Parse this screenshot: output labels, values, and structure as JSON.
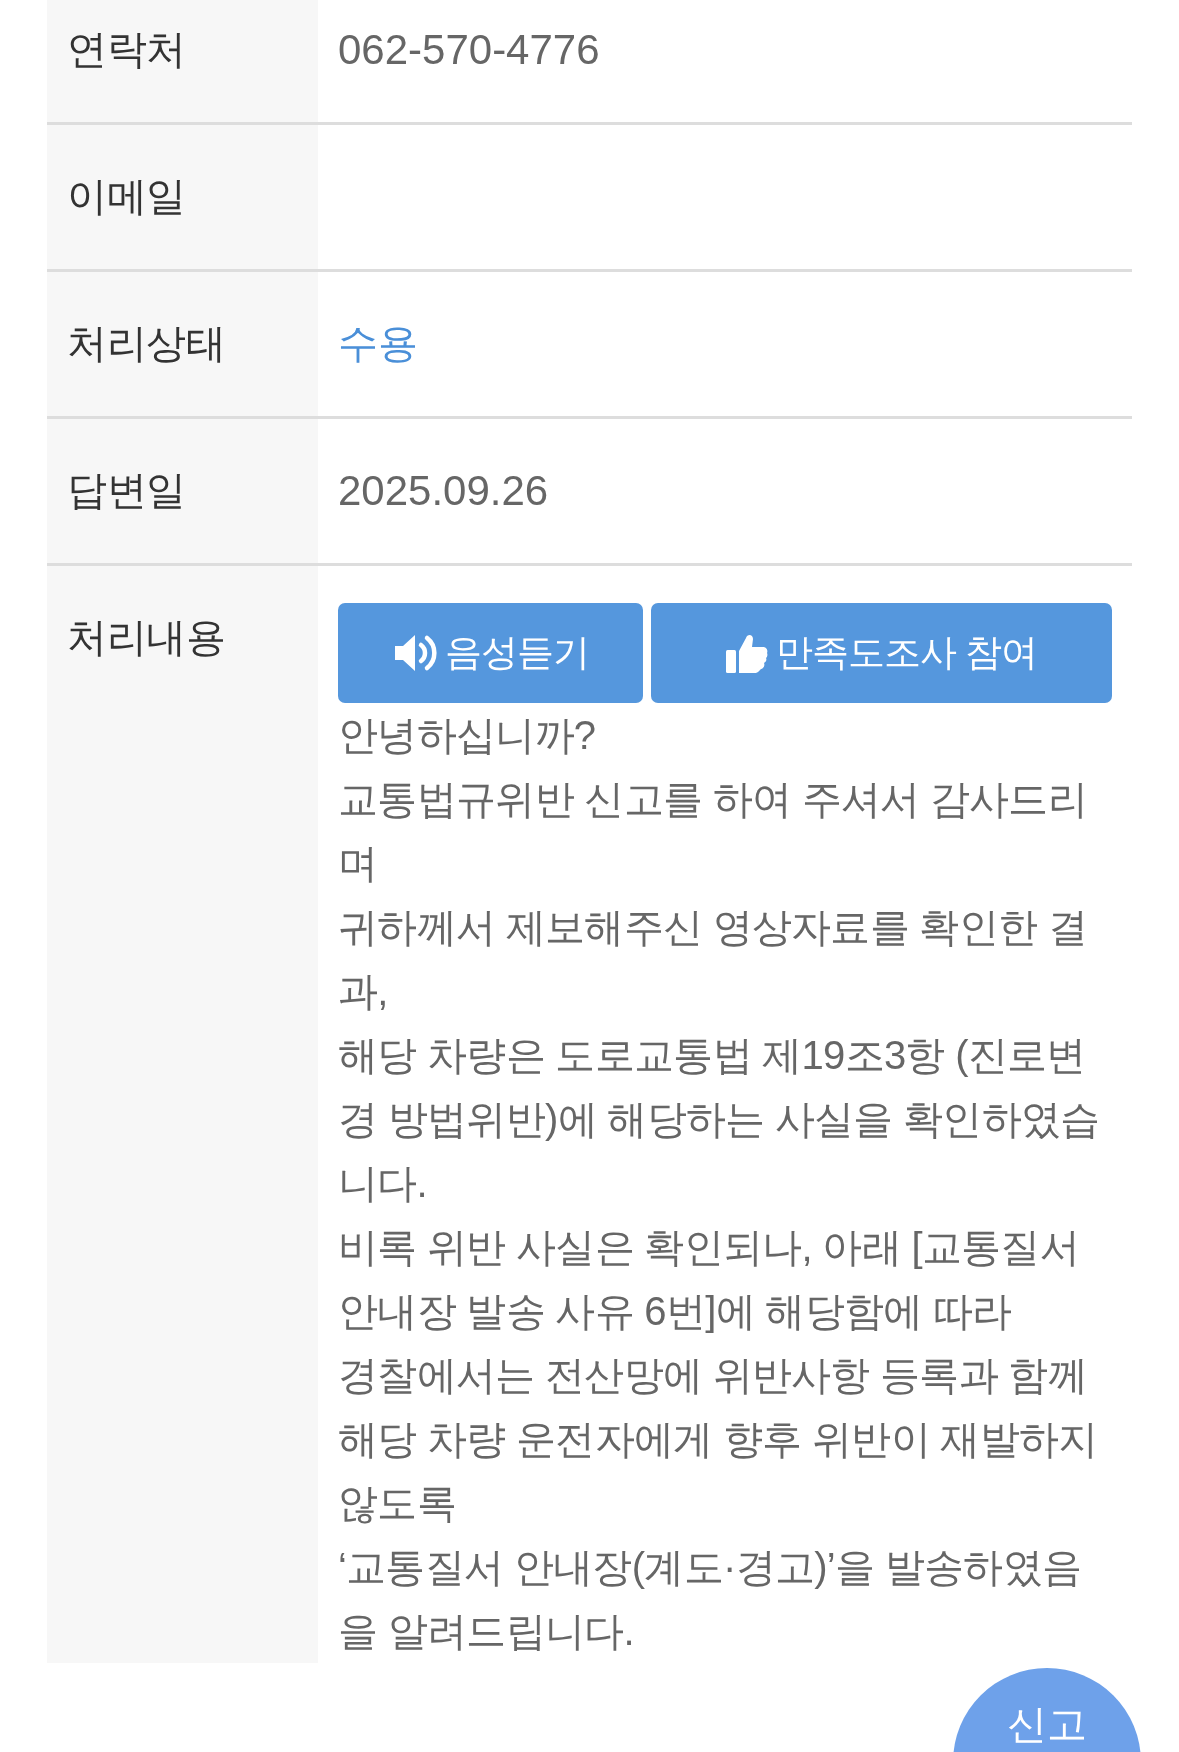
{
  "fields": [
    {
      "label": "연락처",
      "kind": "text",
      "value": "062-570-4776"
    },
    {
      "label": "이메일",
      "kind": "text"
    },
    {
      "label": "처리상태",
      "kind": "status",
      "value": "수용"
    },
    {
      "label": "답변일",
      "kind": "text",
      "value": "2025.09.26"
    },
    {
      "label": "처리내용",
      "kind": "reply",
      "buttons": [
        {
          "label": "음성듣기",
          "kind": "audio"
        },
        {
          "label": "만족도조사 참여",
          "kind": "survey"
        }
      ],
      "body": "안녕하십니까?\n교통법규위반 신고를 하여 주셔서 감사드리며\n귀하께서 제보해주신 영상자료를 확인한 결과,\n해당 차량은 도로교통법 제19조3항 (진로변경 방법위반)에 해당하는 사실을 확인하였습니다.\n비록 위반 사실은 확인되나, 아래 [교통질서 안내장 발송 사유 6번]에 해당함에 따라\n경찰에서는 전산망에 위반사항 등록과 함께\n해당 차량 운전자에게 향후 위반이 재발하지 않도록\n‘교통질서 안내장(계도·경고)’을 발송하였음을 알려드립니다."
    }
  ],
  "floating_button": {
    "label": "신고"
  }
}
